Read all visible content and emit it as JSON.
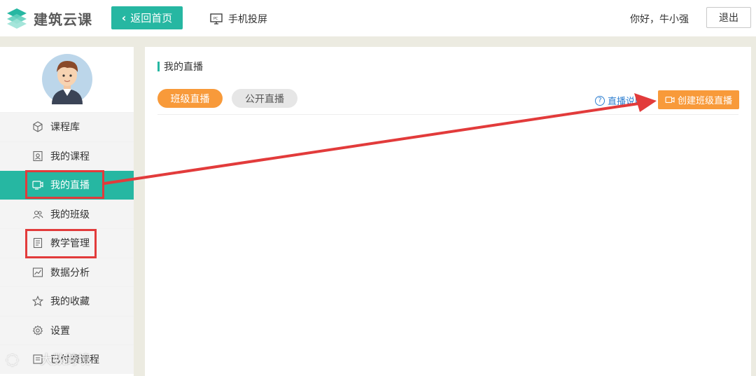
{
  "header": {
    "brand": "建筑云课",
    "back_label": "返回首页",
    "cast_label": "手机投屏",
    "greeting": "你好，牛小强",
    "logout_label": "退出"
  },
  "sidebar": {
    "items": [
      {
        "label": "课程库",
        "icon": "cube-icon"
      },
      {
        "label": "我的课程",
        "icon": "person-card-icon"
      },
      {
        "label": "我的直播",
        "icon": "live-video-icon",
        "active": true
      },
      {
        "label": "我的班级",
        "icon": "group-icon"
      },
      {
        "label": "教学管理",
        "icon": "clipboard-icon"
      },
      {
        "label": "数据分析",
        "icon": "chart-icon"
      },
      {
        "label": "我的收藏",
        "icon": "star-icon"
      },
      {
        "label": "设置",
        "icon": "gear-icon"
      },
      {
        "label": "已付费课程",
        "icon": "paid-icon"
      }
    ]
  },
  "main": {
    "section_title": "我的直播",
    "tabs": [
      {
        "label": "班级直播",
        "active": true
      },
      {
        "label": "公开直播",
        "active": false
      }
    ],
    "help_label": "直播说明",
    "create_label": "创建班级直播"
  },
  "watermark": "大数跨境",
  "colors": {
    "accent": "#26b7a2",
    "orange": "#f89a3a",
    "annotation_red": "#e23b3b",
    "link_blue": "#2e7fd1"
  }
}
